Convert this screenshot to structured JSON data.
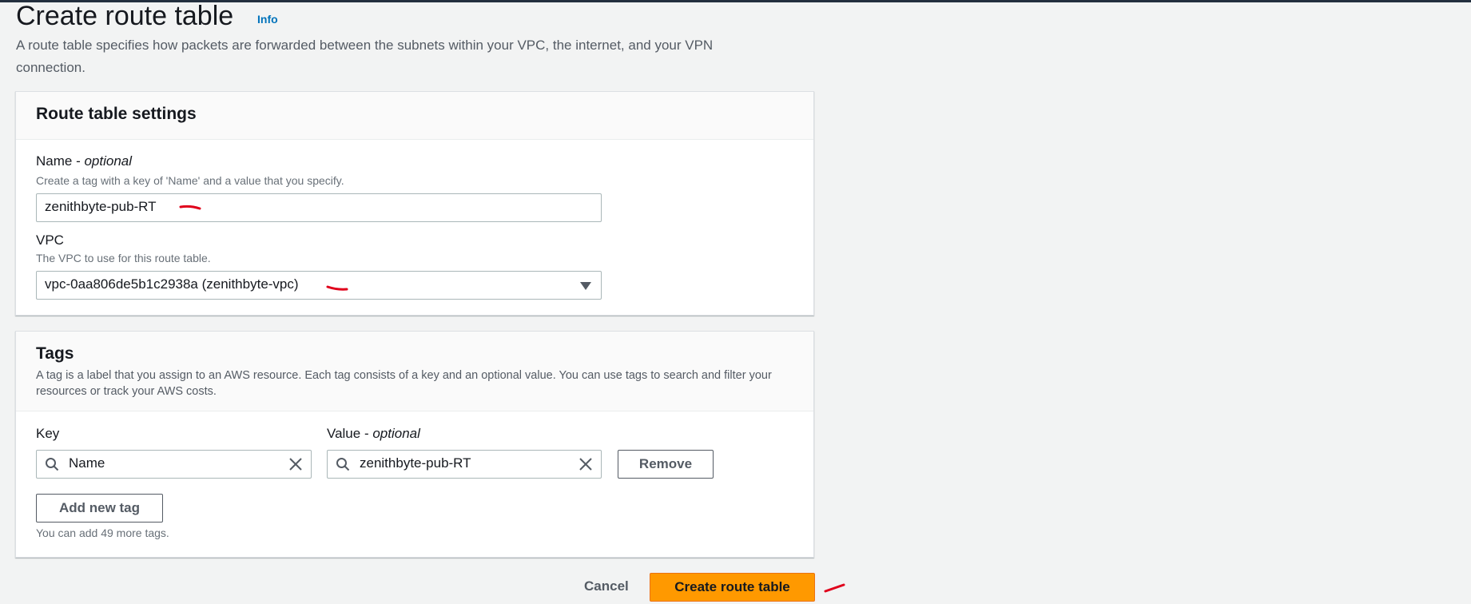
{
  "page": {
    "title": "Create route table",
    "info_link": "Info",
    "description": "A route table specifies how packets are forwarded between the subnets within your VPC, the internet, and your VPN connection."
  },
  "settings": {
    "heading": "Route table settings",
    "name_label": "Name - ",
    "name_label_optional": "optional",
    "name_hint": "Create a tag with a key of 'Name' and a value that you specify.",
    "name_value": "zenithbyte-pub-RT",
    "vpc_label": "VPC",
    "vpc_hint": "The VPC to use for this route table.",
    "vpc_value": "vpc-0aa806de5b1c2938a (zenithbyte-vpc)"
  },
  "tags": {
    "heading": "Tags",
    "description": "A tag is a label that you assign to an AWS resource. Each tag consists of a key and an optional value. You can use tags to search and filter your resources or track your AWS costs.",
    "key_label": "Key",
    "value_label": "Value - ",
    "value_label_optional": "optional",
    "key_value": "Name",
    "value_value": "zenithbyte-pub-RT",
    "remove_label": "Remove",
    "add_label": "Add new tag",
    "limit_hint": "You can add 49 more tags."
  },
  "footer": {
    "cancel_label": "Cancel",
    "create_label": "Create route table"
  },
  "colors": {
    "primary": "#ff9900",
    "link": "#0073bb",
    "annotation": "#e0001b"
  },
  "icons": [
    "search-icon",
    "clear-icon",
    "caret-down-icon"
  ]
}
